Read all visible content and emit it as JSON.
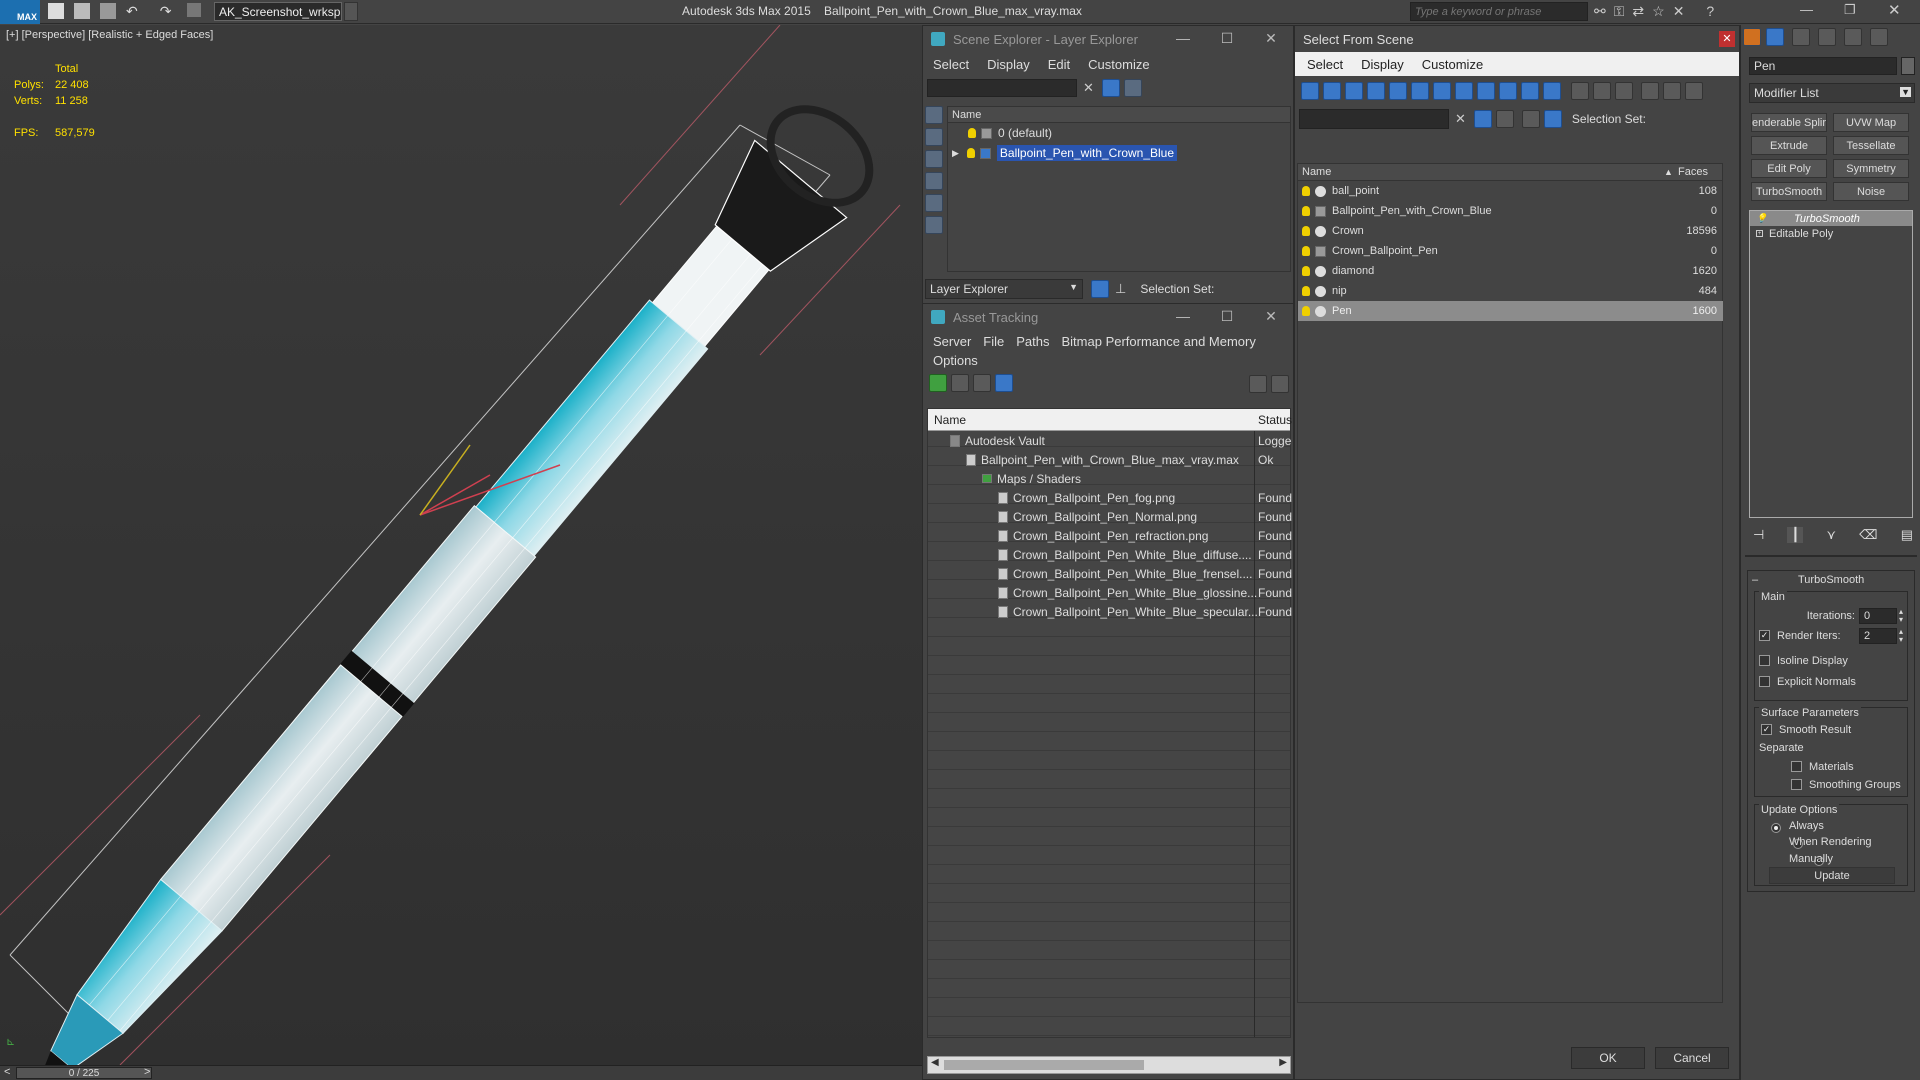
{
  "app": {
    "title": "Autodesk 3ds Max  2015",
    "file": "Ballpoint_Pen_with_Crown_Blue_max_vray.max",
    "workspace": "AK_Screenshot_wrksp",
    "search_placeholder": "Type a keyword or phrase",
    "logo": "MAX"
  },
  "viewport": {
    "label": "[+] [Perspective] [Realistic + Edged Faces]",
    "stats": {
      "total_label": "Total",
      "polys_label": "Polys:",
      "polys": "22 408",
      "verts_label": "Verts:",
      "verts": "11 258",
      "fps_label": "FPS:",
      "fps": "587,579"
    },
    "accent": "#1fb8d0"
  },
  "timeline": {
    "frame": "0 / 225",
    "prev": "<",
    "next": ">"
  },
  "scene_explorer": {
    "title": "Scene Explorer - Layer Explorer",
    "menu": [
      "Select",
      "Display",
      "Edit",
      "Customize"
    ],
    "col_name": "Name",
    "rows": [
      {
        "name": "0 (default)",
        "selected": false
      },
      {
        "name": "Ballpoint_Pen_with_Crown_Blue",
        "selected": true
      }
    ],
    "footer_dropdown": "Layer Explorer",
    "selection_set_label": "Selection Set:"
  },
  "asset_tracking": {
    "title": "Asset Tracking",
    "menu": [
      "Server",
      "File",
      "Paths",
      "Bitmap Performance and Memory"
    ],
    "menu2": "Options",
    "col_name": "Name",
    "col_status": "Status",
    "rows": [
      {
        "name": "Autodesk Vault",
        "status": "Logge"
      },
      {
        "name": "Ballpoint_Pen_with_Crown_Blue_max_vray.max",
        "status": "Ok"
      },
      {
        "name": "Maps / Shaders",
        "status": ""
      },
      {
        "name": "Crown_Ballpoint_Pen_fog.png",
        "status": "Found"
      },
      {
        "name": "Crown_Ballpoint_Pen_Normal.png",
        "status": "Found"
      },
      {
        "name": "Crown_Ballpoint_Pen_refraction.png",
        "status": "Found"
      },
      {
        "name": "Crown_Ballpoint_Pen_White_Blue_diffuse....",
        "status": "Found"
      },
      {
        "name": "Crown_Ballpoint_Pen_White_Blue_frensel....",
        "status": "Found"
      },
      {
        "name": "Crown_Ballpoint_Pen_White_Blue_glossine...",
        "status": "Found"
      },
      {
        "name": "Crown_Ballpoint_Pen_White_Blue_specular...",
        "status": "Found"
      }
    ]
  },
  "select_from_scene": {
    "title": "Select From Scene",
    "menu": [
      "Select",
      "Display",
      "Customize"
    ],
    "selection_set_label": "Selection Set:",
    "col_name": "Name",
    "col_faces": "Faces",
    "rows": [
      {
        "name": "ball_point",
        "faces": "108",
        "icon": "sphere"
      },
      {
        "name": "Ballpoint_Pen_with_Crown_Blue",
        "faces": "0",
        "icon": "group"
      },
      {
        "name": "Crown",
        "faces": "18596",
        "icon": "sphere"
      },
      {
        "name": "Crown_Ballpoint_Pen",
        "faces": "0",
        "icon": "group"
      },
      {
        "name": "diamond",
        "faces": "1620",
        "icon": "sphere"
      },
      {
        "name": "nip",
        "faces": "484",
        "icon": "sphere"
      },
      {
        "name": "Pen",
        "faces": "1600",
        "icon": "sphere"
      }
    ],
    "ok": "OK",
    "cancel": "Cancel"
  },
  "command_panel": {
    "object_name": "Pen",
    "modifier_list": "Modifier List",
    "mod_buttons": [
      "enderable Splir",
      "UVW Map",
      "Extrude",
      "Tessellate",
      "Edit Poly",
      "Symmetry",
      "TurboSmooth",
      "Noise"
    ],
    "stack": [
      "TurboSmooth",
      "Editable Poly"
    ],
    "rollout_title": "TurboSmooth",
    "main_label": "Main",
    "iterations_label": "Iterations:",
    "iterations": "0",
    "render_iters_label": "Render Iters:",
    "render_iters": "2",
    "isoline": "Isoline Display",
    "explicit_normals": "Explicit Normals",
    "surface_params": "Surface Parameters",
    "smooth_result": "Smooth Result",
    "separate": "Separate",
    "materials": "Materials",
    "smoothing_groups": "Smoothing Groups",
    "update_options": "Update Options",
    "always": "Always",
    "when_rendering": "When Rendering",
    "manually": "Manually",
    "update": "Update"
  }
}
